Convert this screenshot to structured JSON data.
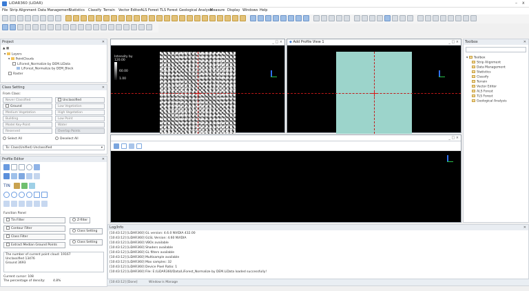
{
  "app": {
    "title": "LiDAR360 (LiDAR)",
    "window_controls": [
      "–",
      "x"
    ]
  },
  "menu": [
    "File",
    "Strip Alignment",
    "Data Management",
    "Statistics",
    "Classify",
    "Terrain",
    "Vector Editor",
    "ALS Forest",
    "TLS Forest",
    "Geological Analysis",
    "Measure",
    "Display",
    "Windows",
    "Help"
  ],
  "project": {
    "header": "Project",
    "root": "Layers",
    "group": "PointClouds",
    "file": "LiForest_Normalize by DEM.LiData",
    "subfile": "LiForest_Normalize by DEM_Block",
    "raster": "Raster"
  },
  "class_setting": {
    "header": "Class Setting",
    "from_class_label": "From Class:",
    "from_list": [
      "Never Classified",
      "Unclassified",
      "Ground",
      "Low Vegetation",
      "Medium Vegetation",
      "High Vegetation",
      "Building",
      "Low Point",
      "Model Key-Point",
      "Water",
      "Reserved",
      "Overlap Points"
    ],
    "select_all": "Select All",
    "deselect_all": "Deselect All",
    "to_class": "To: Class(Unified) Unclassified"
  },
  "profile_editor": {
    "header": "Profile Editor",
    "function_panel": "Function Panel",
    "buttons": {
      "tin_filter": "Tin Filter",
      "z_filter": "Z-filter",
      "contour_filter": "Contour Filter",
      "class_setting_1": "Class Setting",
      "class_filter": "Class Filter",
      "class_setting_2": "Class Setting",
      "extract_median": "Extract Median Ground Points"
    },
    "info_lines": [
      "The number of current point cloud: 19167",
      "Unclassified 13476",
      "Ground 3693"
    ],
    "current_cursor": "Current cursor: 108",
    "percentage_label": "The percentage of density:",
    "percentage_value": "4.8%"
  },
  "views": {
    "view1_title": "",
    "view2_title": "Add Profile View 1",
    "view3_title": "",
    "legend_title": "Intensity by",
    "legend_values": [
      "120.00",
      "60.00",
      "1.00"
    ],
    "view_controls": "_ □ ×"
  },
  "toolbox": {
    "header": "Toolbox",
    "search_placeholder": "",
    "items": [
      "Toolbox",
      "Strip Alignment",
      "Data Management",
      "Statistics",
      "Classify",
      "Terrain",
      "Vector Editor",
      "ALS Forest",
      "TLS Forest",
      "Geological Analysis"
    ]
  },
  "log": {
    "header": "Log/Info",
    "lines": [
      "[10:43:12] [LiDAR360]   GL version: 4.6.0 NVIDIA 432.00",
      "[10:43:12] [LiDAR360]   GLSL Version: 4.60 NVIDIA",
      "[10:43:12] [LiDAR360]   VBOs available",
      "[10:43:12] [LiDAR360]   Shaders available",
      "[10:43:12] [LiDAR360]   GL filters available",
      "[10:43:12] [LiDAR360]   Multisample available",
      "[10:43:12] [LiDAR360]   Max samples: 32",
      "[10:43:12] [LiDAR360]   Device Pixel Ratio: 1",
      "[10:43:12] [LiDAR360]   File: E:/LiDAR360/Data/LiForest_Normalize by DEM.LiData loaded successfully!"
    ],
    "status_left": "[10:43:12] [Done]",
    "status_right": "Window is Manage"
  }
}
